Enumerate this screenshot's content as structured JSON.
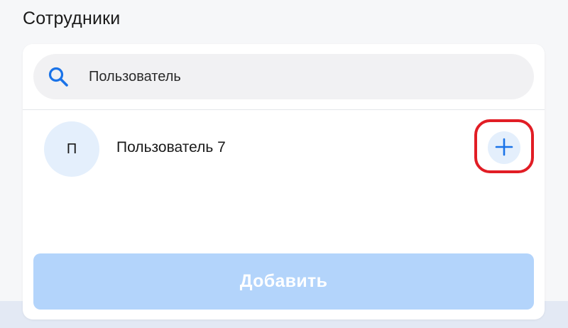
{
  "header": {
    "title": "Сотрудники"
  },
  "search": {
    "value": "Пользователь",
    "icon": "search-icon"
  },
  "results": [
    {
      "avatar_initial": "П",
      "name": "Пользователь 7",
      "action_icon": "plus-icon"
    }
  ],
  "footer": {
    "submit_label": "Добавить"
  },
  "colors": {
    "accent": "#1a73e8",
    "avatar_bg": "#e4effc",
    "submit_disabled_bg": "#b3d4fb",
    "highlight": "#e11d25"
  }
}
